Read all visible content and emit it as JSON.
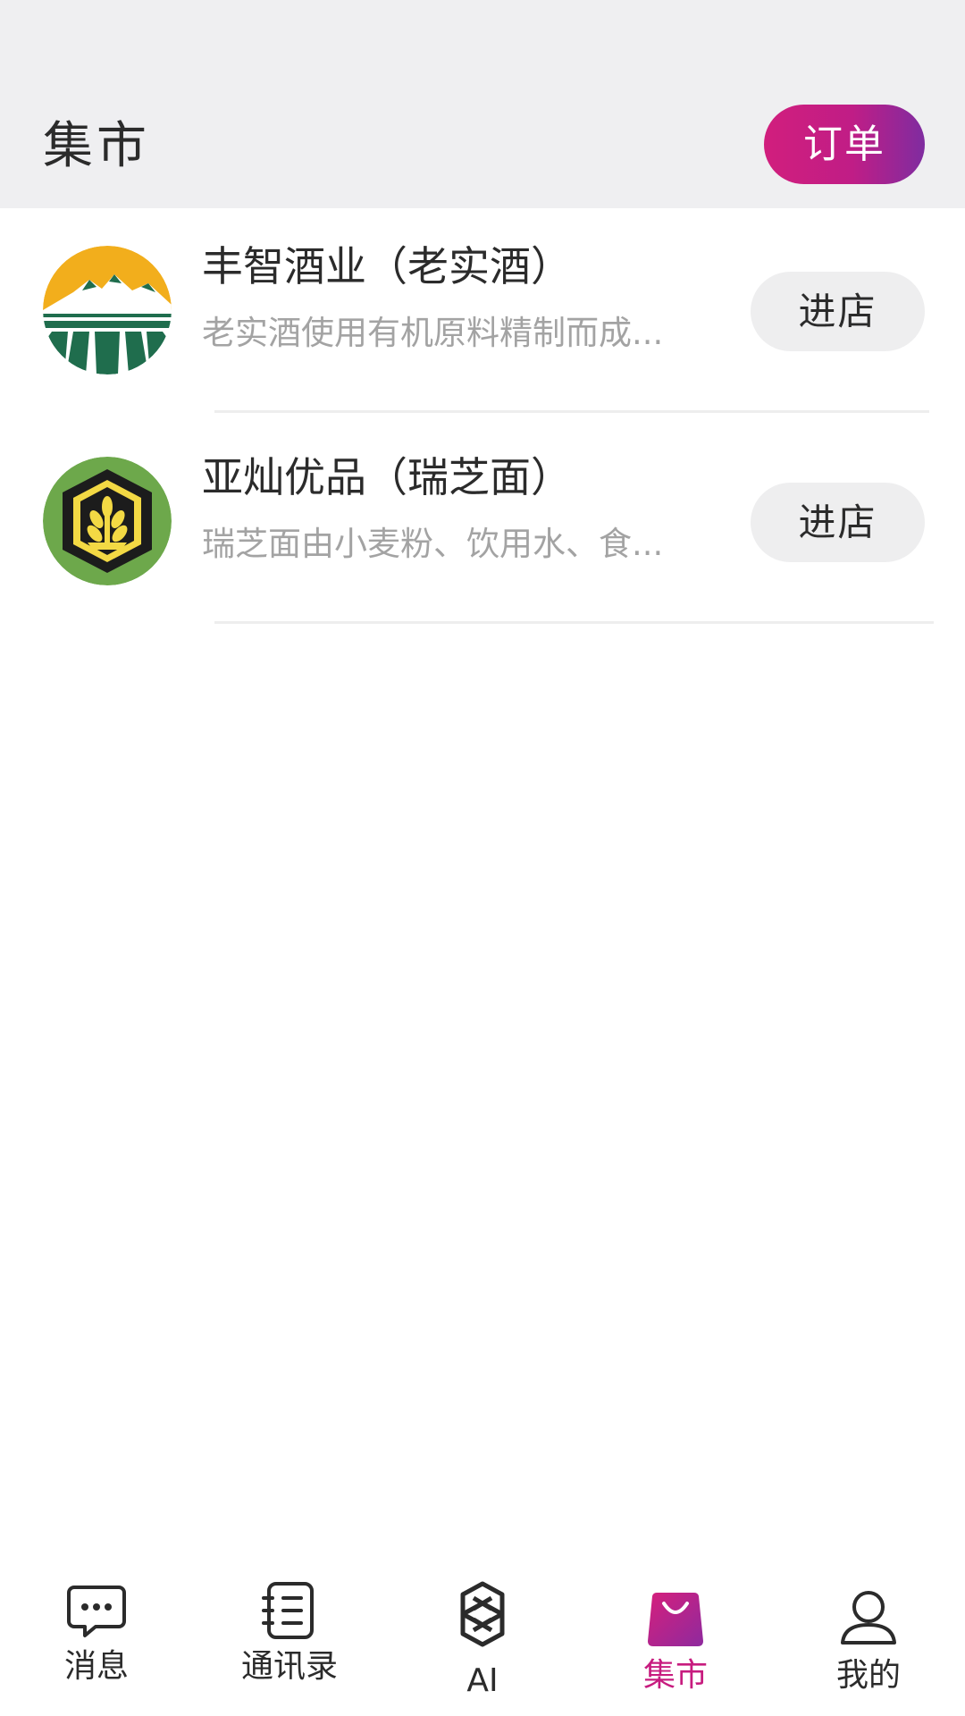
{
  "header": {
    "title": "集市",
    "orders_label": "订单"
  },
  "shops": [
    {
      "name": "丰智酒业（老实酒）",
      "description": "老实酒使用有机原料精制而成...",
      "enter_label": "进店",
      "logo_icon": "mountain-field-logo"
    },
    {
      "name": "亚灿优品（瑞芝面）",
      "description": "瑞芝面由小麦粉、饮用水、食...",
      "enter_label": "进店",
      "logo_icon": "wheat-badge-logo"
    }
  ],
  "bottom_nav": {
    "items": [
      {
        "label": "消息",
        "icon": "chat-bubble-icon",
        "active": false
      },
      {
        "label": "通讯录",
        "icon": "contacts-book-icon",
        "active": false
      },
      {
        "label": "AI",
        "icon": "ai-knot-icon",
        "active": false
      },
      {
        "label": "集市",
        "icon": "shopping-bag-icon",
        "active": true
      },
      {
        "label": "我的",
        "icon": "user-icon",
        "active": false
      }
    ]
  },
  "colors": {
    "accent": "#c71c7f",
    "accent_gradient_end": "#7f2ca0",
    "header_bg": "#efeff1",
    "button_bg": "#eeeeef",
    "muted_text": "#a3a3a3"
  }
}
